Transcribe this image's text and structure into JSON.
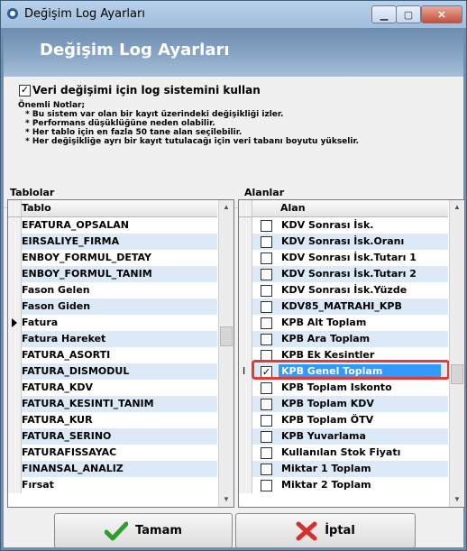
{
  "window": {
    "title": "Değişim Log Ayarları"
  },
  "banner": {
    "title": "Değişim Log Ayarları"
  },
  "settings": {
    "log_enabled": true,
    "log_label": "Veri değişimi için log sistemini kullan",
    "notes_title": "Önemli Notlar;",
    "notes": [
      "* Bu sistem var olan bir kayıt üzerindeki değişikliği izler.",
      "* Performans düşüklüğüne neden olabilir.",
      "* Her tablo için en fazla 50 tane alan seçilebilir.",
      "* Her değişikliğe ayrı bir kayıt tutulacağı için veri tabanı boyutu yükselir."
    ]
  },
  "tables": {
    "section_label": "Tablolar",
    "column_header": "Tablo",
    "current_row_index": 6,
    "rows": [
      "EFATURA_OPSALAN",
      "EIRSALIYE_FIRMA",
      "ENBOY_FORMUL_DETAY",
      "ENBOY_FORMUL_TANIM",
      "Fason Gelen",
      "Fason Giden",
      "Fatura",
      "Fatura Hareket",
      "FATURA_ASORTI",
      "FATURA_DISMODUL",
      "FATURA_KDV",
      "FATURA_KESINTI_TANIM",
      "FATURA_KUR",
      "FATURA_SERINO",
      "FATURAFISSAYAC",
      "FINANSAL_ANALIZ",
      "Fırsat"
    ]
  },
  "fields": {
    "section_label": "Alanlar",
    "column_header": "Alan",
    "selected_row_index": 9,
    "rows": [
      {
        "label": "KDV Sonrası İsk.",
        "checked": false
      },
      {
        "label": "KDV Sonrası İsk.Oranı",
        "checked": false
      },
      {
        "label": "KDV Sonrası İsk.Tutarı 1",
        "checked": false
      },
      {
        "label": "KDV Sonrası İsk.Tutarı 2",
        "checked": false
      },
      {
        "label": "KDV Sonrası İsk.Yüzde",
        "checked": false
      },
      {
        "label": "KDV85_MATRAHI_KPB",
        "checked": false
      },
      {
        "label": "KPB Alt Toplam",
        "checked": false
      },
      {
        "label": "KPB Ara Toplam",
        "checked": false
      },
      {
        "label": "KPB Ek Kesintler",
        "checked": false
      },
      {
        "label": "KPB Genel Toplam",
        "checked": true
      },
      {
        "label": "KPB Toplam Iskonto",
        "checked": false
      },
      {
        "label": "KPB Toplam KDV",
        "checked": false
      },
      {
        "label": "KPB Toplam ÖTV",
        "checked": false
      },
      {
        "label": "KPB Yuvarlama",
        "checked": false
      },
      {
        "label": "Kullanılan Stok Fiyatı",
        "checked": false
      },
      {
        "label": "Miktar 1 Toplam",
        "checked": false
      },
      {
        "label": "Miktar 2 Toplam",
        "checked": false
      }
    ]
  },
  "buttons": {
    "ok_label": "Tamam",
    "cancel_label": "İptal"
  },
  "colors": {
    "alt_row": "#dce9f7",
    "selection": "#3399ff",
    "highlight_border": "#e53935"
  }
}
